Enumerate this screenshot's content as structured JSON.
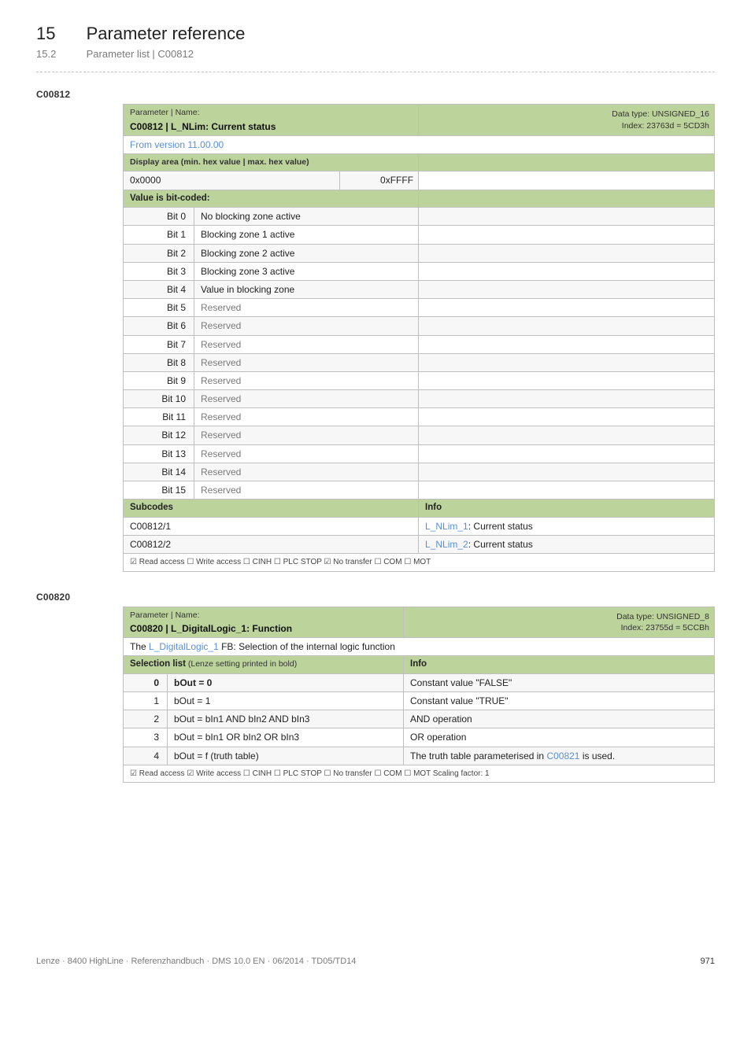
{
  "page": {
    "chapter_num": "15",
    "chapter_title": "Parameter reference",
    "section_num": "15.2",
    "section_title": "Parameter list | C00812"
  },
  "t1": {
    "code": "C00812",
    "hdr_pn": "Parameter | Name:",
    "hdr_name": "C00812 | L_NLim: Current status",
    "hdr_dt": "Data type: UNSIGNED_16",
    "hdr_idx": "Index: 23763d = 5CD3h",
    "version": "From version 11.00.00",
    "disp_label": "Display area (min. hex value | max. hex value)",
    "disp_min": "0x0000",
    "disp_max": "0xFFFF",
    "bitcoded": "Value is bit-coded:",
    "bits": [
      {
        "n": "Bit 0",
        "d": "No blocking zone active"
      },
      {
        "n": "Bit 1",
        "d": "Blocking zone 1 active"
      },
      {
        "n": "Bit 2",
        "d": "Blocking zone 2 active"
      },
      {
        "n": "Bit 3",
        "d": "Blocking zone 3 active"
      },
      {
        "n": "Bit 4",
        "d": "Value in blocking zone"
      },
      {
        "n": "Bit 5",
        "d": "Reserved"
      },
      {
        "n": "Bit 6",
        "d": "Reserved"
      },
      {
        "n": "Bit 7",
        "d": "Reserved"
      },
      {
        "n": "Bit 8",
        "d": "Reserved"
      },
      {
        "n": "Bit 9",
        "d": "Reserved"
      },
      {
        "n": "Bit 10",
        "d": "Reserved"
      },
      {
        "n": "Bit 11",
        "d": "Reserved"
      },
      {
        "n": "Bit 12",
        "d": "Reserved"
      },
      {
        "n": "Bit 13",
        "d": "Reserved"
      },
      {
        "n": "Bit 14",
        "d": "Reserved"
      },
      {
        "n": "Bit 15",
        "d": "Reserved"
      }
    ],
    "subcodes_label": "Subcodes",
    "info_label": "Info",
    "subcodes": [
      {
        "c": "C00812/1",
        "link": "L_NLim_1",
        "t": ": Current status"
      },
      {
        "c": "C00812/2",
        "link": "L_NLim_2",
        "t": ": Current status"
      }
    ],
    "checks": "☑ Read access   ☐ Write access   ☐ CINH   ☐ PLC STOP   ☑ No transfer   ☐ COM   ☐ MOT"
  },
  "t2": {
    "code": "C00820",
    "hdr_pn": "Parameter | Name:",
    "hdr_name": "C00820 | L_DigitalLogic_1: Function",
    "hdr_dt": "Data type: UNSIGNED_8",
    "hdr_idx": "Index: 23755d = 5CCBh",
    "intro_pre": "The ",
    "intro_link": "L_DigitalLogic_1",
    "intro_post": " FB: Selection of the internal logic function",
    "sel_label": "Selection list",
    "sel_label_small": " (Lenze setting printed in bold)",
    "info_label": "Info",
    "rows": [
      {
        "n": "0",
        "o": "bOut = 0",
        "bold": true,
        "info": "Constant value \"FALSE\"",
        "link": ""
      },
      {
        "n": "1",
        "o": "bOut = 1",
        "bold": false,
        "info": "Constant value \"TRUE\"",
        "link": ""
      },
      {
        "n": "2",
        "o": "bOut = bIn1 AND bIn2 AND bIn3",
        "bold": false,
        "info": "AND operation",
        "link": ""
      },
      {
        "n": "3",
        "o": "bOut = bIn1 OR bIn2 OR bIn3",
        "bold": false,
        "info": "OR operation",
        "link": ""
      },
      {
        "n": "4",
        "o": "bOut = f (truth table)",
        "bold": false,
        "info": "The truth table parameterised in ",
        "link": "C00821",
        "info2": " is used."
      }
    ],
    "checks": "☑ Read access   ☑ Write access   ☐ CINH   ☐ PLC STOP   ☐ No transfer   ☐ COM   ☐ MOT     Scaling factor: 1"
  },
  "footer": {
    "left": "Lenze · 8400 HighLine · Referenzhandbuch · DMS 10.0 EN · 06/2014 · TD05/TD14",
    "page": "971"
  }
}
